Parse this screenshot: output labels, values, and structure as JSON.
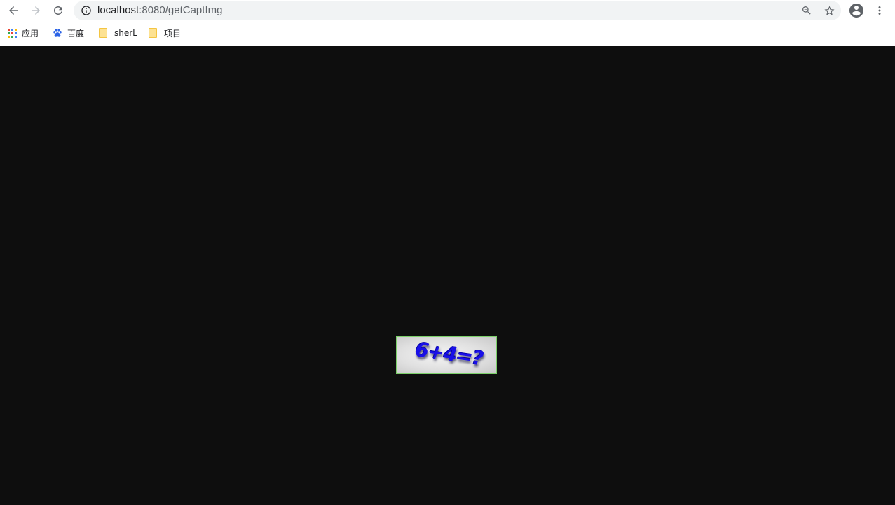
{
  "browser": {
    "url_host": "localhost",
    "url_rest": ":8080/getCaptImg",
    "icons": {
      "back": "arrow-left-icon",
      "forward": "arrow-right-icon",
      "reload": "reload-icon",
      "site_info": "info-icon",
      "zoom": "zoom-out-icon",
      "bookmark_star": "star-icon",
      "profile": "account-circle-icon",
      "menu": "more-vert-icon"
    }
  },
  "bookmarks": {
    "items": [
      {
        "label": "应用",
        "icon": "apps-grid-icon"
      },
      {
        "label": "百度",
        "icon": "baidu-paw-icon"
      },
      {
        "label": "sherL",
        "icon": "folder-icon"
      },
      {
        "label": "项目",
        "icon": "folder-icon"
      }
    ]
  },
  "page": {
    "captcha_text": "6+4=?",
    "background_color": "#0e0e0e",
    "captcha_text_color": "#1a10e8",
    "captcha_border_color": "#7ccf6a"
  }
}
